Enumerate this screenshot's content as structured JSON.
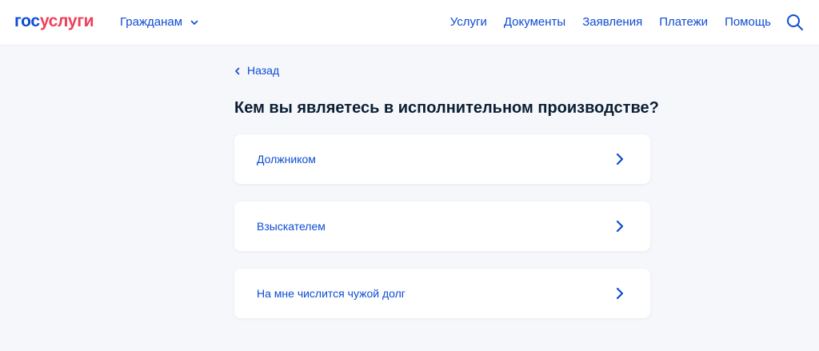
{
  "header": {
    "logo": {
      "part1": "гос",
      "part2": "услуги"
    },
    "audience": "Гражданам",
    "nav": [
      "Услуги",
      "Документы",
      "Заявления",
      "Платежи",
      "Помощь"
    ]
  },
  "main": {
    "back_label": "Назад",
    "title": "Кем вы являетесь в исполнительном производстве?",
    "options": [
      "Должником",
      "Взыскателем",
      "На мне числится чужой долг"
    ]
  },
  "colors": {
    "brand_blue": "#0d4cd3",
    "brand_red": "#ee3f58",
    "text_dark": "#0b1f33",
    "page_bg": "#f5f7fb"
  },
  "icons": {
    "audience_toggle": "chevron-down-icon",
    "search": "search-icon",
    "back": "chevron-left-icon",
    "option_arrow": "chevron-right-icon"
  }
}
